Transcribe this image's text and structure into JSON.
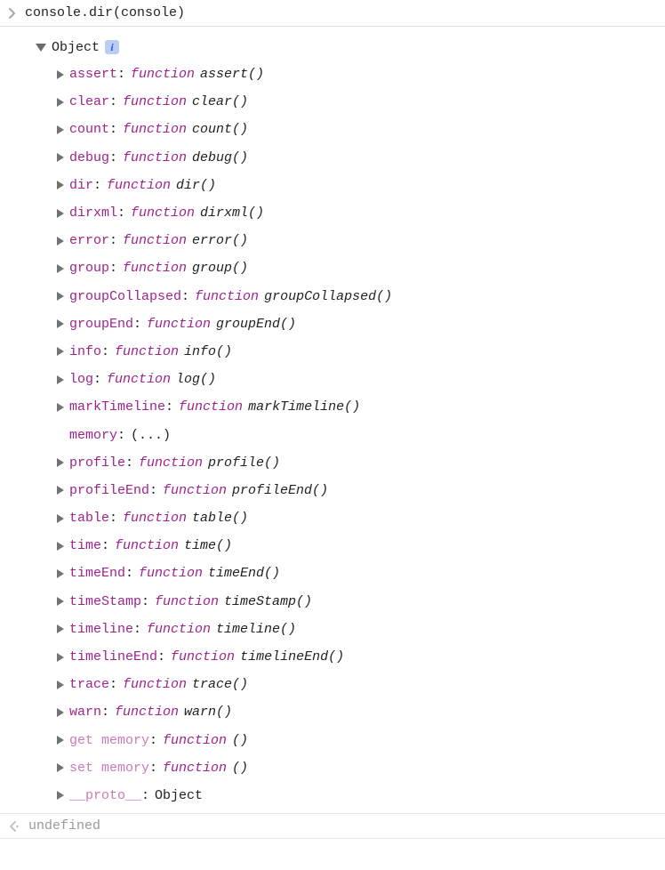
{
  "input": {
    "command": "console.dir(console)"
  },
  "object": {
    "header": "Object"
  },
  "props": [
    {
      "key": "assert",
      "type": "func",
      "funcName": "assert()",
      "arrow": true
    },
    {
      "key": "clear",
      "type": "func",
      "funcName": "clear()",
      "arrow": true
    },
    {
      "key": "count",
      "type": "func",
      "funcName": "count()",
      "arrow": true
    },
    {
      "key": "debug",
      "type": "func",
      "funcName": "debug()",
      "arrow": true
    },
    {
      "key": "dir",
      "type": "func",
      "funcName": "dir()",
      "arrow": true
    },
    {
      "key": "dirxml",
      "type": "func",
      "funcName": "dirxml()",
      "arrow": true
    },
    {
      "key": "error",
      "type": "func",
      "funcName": "error()",
      "arrow": true
    },
    {
      "key": "group",
      "type": "func",
      "funcName": "group()",
      "arrow": true
    },
    {
      "key": "groupCollapsed",
      "type": "func",
      "funcName": "groupCollapsed()",
      "arrow": true
    },
    {
      "key": "groupEnd",
      "type": "func",
      "funcName": "groupEnd()",
      "arrow": true
    },
    {
      "key": "info",
      "type": "func",
      "funcName": "info()",
      "arrow": true
    },
    {
      "key": "log",
      "type": "func",
      "funcName": "log()",
      "arrow": true
    },
    {
      "key": "markTimeline",
      "type": "func",
      "funcName": "markTimeline()",
      "arrow": true
    },
    {
      "key": "memory",
      "type": "plain",
      "value": "(...)",
      "arrow": false
    },
    {
      "key": "profile",
      "type": "func",
      "funcName": "profile()",
      "arrow": true
    },
    {
      "key": "profileEnd",
      "type": "func",
      "funcName": "profileEnd()",
      "arrow": true
    },
    {
      "key": "table",
      "type": "func",
      "funcName": "table()",
      "arrow": true
    },
    {
      "key": "time",
      "type": "func",
      "funcName": "time()",
      "arrow": true
    },
    {
      "key": "timeEnd",
      "type": "func",
      "funcName": "timeEnd()",
      "arrow": true
    },
    {
      "key": "timeStamp",
      "type": "func",
      "funcName": "timeStamp()",
      "arrow": true
    },
    {
      "key": "timeline",
      "type": "func",
      "funcName": "timeline()",
      "arrow": true
    },
    {
      "key": "timelineEnd",
      "type": "func",
      "funcName": "timelineEnd()",
      "arrow": true
    },
    {
      "key": "trace",
      "type": "func",
      "funcName": "trace()",
      "arrow": true
    },
    {
      "key": "warn",
      "type": "func",
      "funcName": "warn()",
      "arrow": true
    },
    {
      "key": "get memory",
      "type": "func",
      "funcName": "()",
      "arrow": true,
      "dim": true
    },
    {
      "key": "set memory",
      "type": "func",
      "funcName": "()",
      "arrow": true,
      "dim": true
    },
    {
      "key": "__proto__",
      "type": "plain",
      "value": "Object",
      "arrow": true,
      "dim": true
    }
  ],
  "funcKeyword": "function",
  "return": {
    "value": "undefined"
  }
}
